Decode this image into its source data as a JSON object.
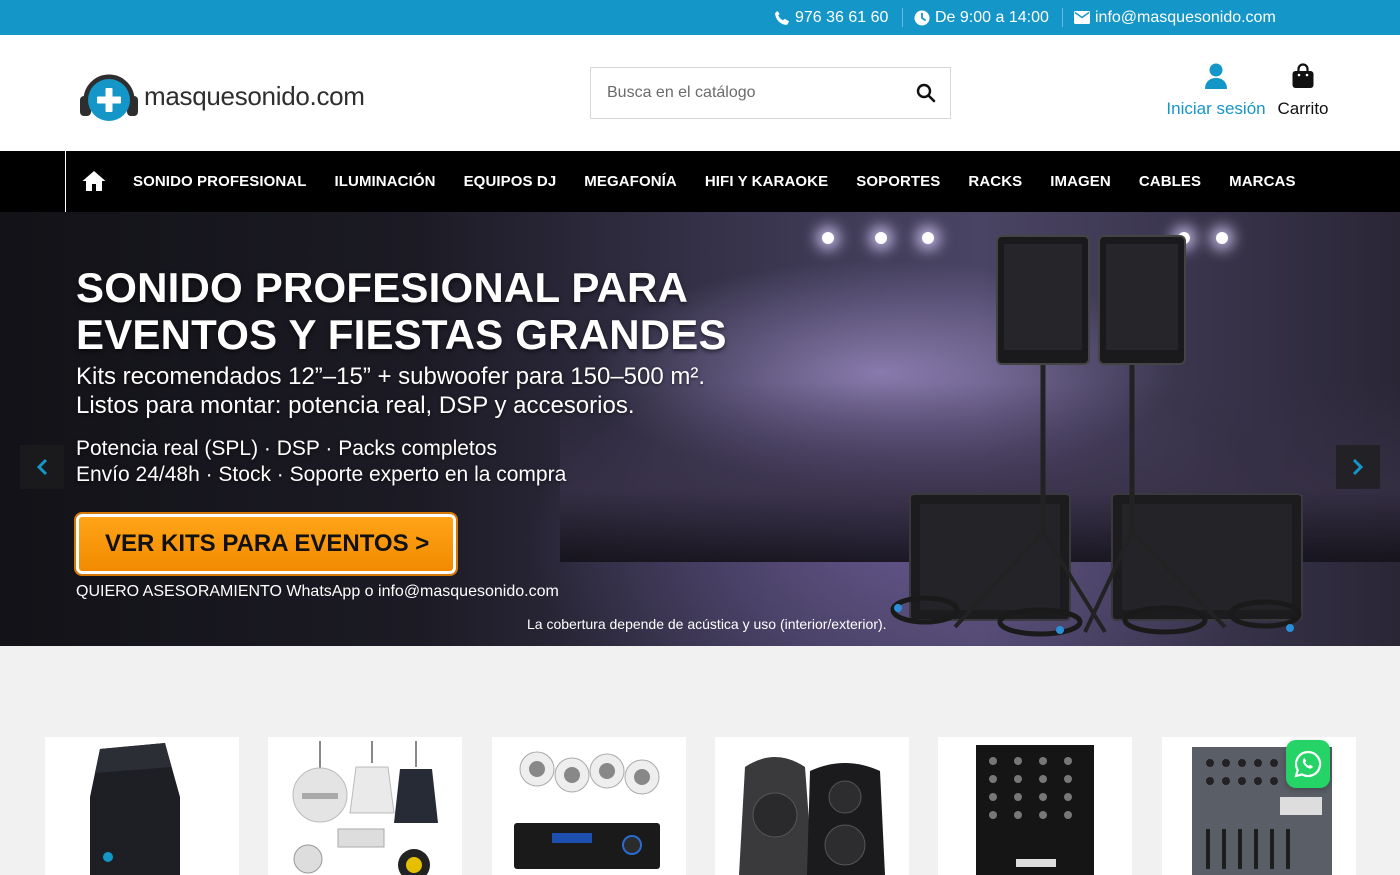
{
  "topbar": {
    "phone": "976 36 61 60",
    "hours": "De 9:00 a 14:00",
    "email": "info@masquesonido.com"
  },
  "header": {
    "logo_text": "masquesonido.com",
    "search_placeholder": "Busca en el catálogo",
    "login_label": "Iniciar sesión",
    "cart_label": "Carrito"
  },
  "nav": {
    "items": [
      "SONIDO PROFESIONAL",
      "ILUMINACIÓN",
      "EQUIPOS DJ",
      "MEGAFONÍA",
      "HIFI Y KARAOKE",
      "SOPORTES",
      "RACKS",
      "IMAGEN",
      "CABLES",
      "MARCAS"
    ]
  },
  "hero": {
    "title_line1": "SONIDO PROFESIONAL PARA",
    "title_line2": "EVENTOS Y FIESTAS GRANDES",
    "sub_line1": "Kits recomendados 12”–15” + subwoofer para 150–500 m².",
    "sub_line2": "Listos para montar: potencia real, DSP y accesorios.",
    "feat_line1": "Potencia real (SPL) · DSP · Packs completos",
    "feat_line2": "Envío 24/48h · Stock · Soporte experto en la compra",
    "cta_label": "VER KITS PARA EVENTOS >",
    "note": "QUIERO ASESORAMIENTO WhatsApp o info@masquesonido.com",
    "disclaimer": "La cobertura depende de acústica y uso (interior/exterior)."
  },
  "icons": {
    "phone": "phone-icon",
    "clock": "clock-icon",
    "mail": "envelope-icon",
    "search": "search-icon",
    "user": "user-icon",
    "cart": "shopping-bag-icon",
    "home": "home-icon",
    "whatsapp": "whatsapp-icon"
  },
  "colors": {
    "brand_blue": "#1596c8",
    "nav_bg": "#000000",
    "cta_orange": "#f7941d",
    "whatsapp_green": "#25d366"
  }
}
